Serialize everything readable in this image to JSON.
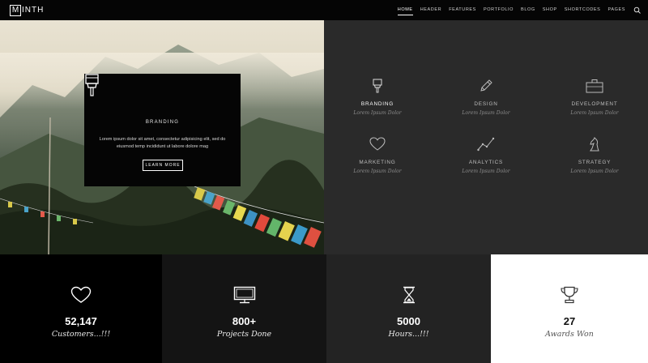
{
  "logo": {
    "box_letter": "M",
    "rest": "INTH"
  },
  "nav": {
    "items": [
      "HOME",
      "HEADER",
      "FEATURES",
      "PORTFOLIO",
      "BLOG",
      "SHOP",
      "SHORTCODES",
      "PAGES"
    ],
    "active": "HOME",
    "search_icon": "search-icon"
  },
  "hero_card": {
    "icon": "paint-brush-icon",
    "title": "BRANDING",
    "text": "Lorem ipsum dolor sit amet, consectetur adipisicing elit, sed do eiusmod temp incididunt ut labore dolore mag",
    "button": "LEARN MORE"
  },
  "features": [
    {
      "icon": "paint-brush-icon",
      "title": "BRANDING",
      "subtitle": "Lorem Ipsum Dolor"
    },
    {
      "icon": "pencil-icon",
      "title": "DESIGN",
      "subtitle": "Lorem Ipsum Dolor"
    },
    {
      "icon": "briefcase-icon",
      "title": "DEVELOPMENT",
      "subtitle": "Lorem Ipsum Dolor"
    },
    {
      "icon": "heart-icon",
      "title": "MARKETING",
      "subtitle": "Lorem Ipsum Dolor"
    },
    {
      "icon": "line-chart-icon",
      "title": "ANALYTICS",
      "subtitle": "Lorem Ipsum Dolor"
    },
    {
      "icon": "chess-knight-icon",
      "title": "STRATEGY",
      "subtitle": "Lorem Ipsum Dolor"
    }
  ],
  "stats": [
    {
      "icon": "heart-icon",
      "number": "52,147",
      "label": "Customers...!!!"
    },
    {
      "icon": "monitor-icon",
      "number": "800+",
      "label": "Projects Done"
    },
    {
      "icon": "hourglass-icon",
      "number": "5000",
      "label": "Hours...!!!"
    },
    {
      "icon": "trophy-icon",
      "number": "27",
      "label": "Awards Won"
    }
  ],
  "colors": {
    "feature_bg": "#2a2a2a",
    "stat_bg_1": "#000000",
    "stat_bg_2": "#141414",
    "stat_bg_3": "#232323",
    "stat_bg_4": "#ffffff"
  }
}
